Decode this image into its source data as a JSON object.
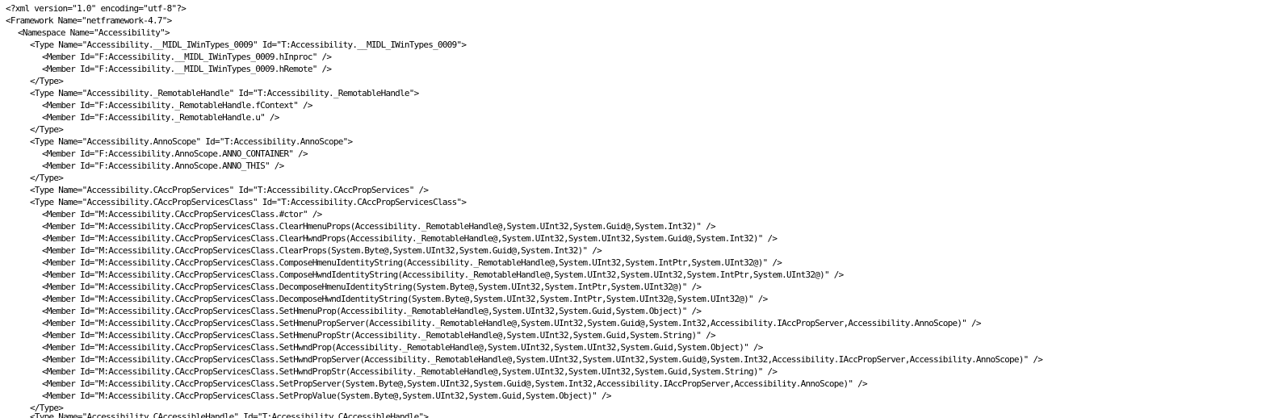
{
  "document": {
    "lines": [
      {
        "indent": 0,
        "text": "<?xml version=\"1.0\" encoding=\"utf-8\"?>"
      },
      {
        "indent": 0,
        "text": "<Framework Name=\"netframework-4.7\">"
      },
      {
        "indent": 1,
        "text": "<Namespace Name=\"Accessibility\">"
      },
      {
        "indent": 2,
        "text": "<Type Name=\"Accessibility.__MIDL_IWinTypes_0009\" Id=\"T:Accessibility.__MIDL_IWinTypes_0009\">"
      },
      {
        "indent": 3,
        "text": "<Member Id=\"F:Accessibility.__MIDL_IWinTypes_0009.hInproc\" />"
      },
      {
        "indent": 3,
        "text": "<Member Id=\"F:Accessibility.__MIDL_IWinTypes_0009.hRemote\" />"
      },
      {
        "indent": 2,
        "text": "</Type>"
      },
      {
        "indent": 2,
        "text": "<Type Name=\"Accessibility._RemotableHandle\" Id=\"T:Accessibility._RemotableHandle\">"
      },
      {
        "indent": 3,
        "text": "<Member Id=\"F:Accessibility._RemotableHandle.fContext\" />"
      },
      {
        "indent": 3,
        "text": "<Member Id=\"F:Accessibility._RemotableHandle.u\" />"
      },
      {
        "indent": 2,
        "text": "</Type>"
      },
      {
        "indent": 2,
        "text": "<Type Name=\"Accessibility.AnnoScope\" Id=\"T:Accessibility.AnnoScope\">"
      },
      {
        "indent": 3,
        "text": "<Member Id=\"F:Accessibility.AnnoScope.ANNO_CONTAINER\" />"
      },
      {
        "indent": 3,
        "text": "<Member Id=\"F:Accessibility.AnnoScope.ANNO_THIS\" />"
      },
      {
        "indent": 2,
        "text": "</Type>"
      },
      {
        "indent": 2,
        "text": "<Type Name=\"Accessibility.CAccPropServices\" Id=\"T:Accessibility.CAccPropServices\" />"
      },
      {
        "indent": 2,
        "text": "<Type Name=\"Accessibility.CAccPropServicesClass\" Id=\"T:Accessibility.CAccPropServicesClass\">"
      },
      {
        "indent": 3,
        "text": "<Member Id=\"M:Accessibility.CAccPropServicesClass.#ctor\" />"
      },
      {
        "indent": 3,
        "text": "<Member Id=\"M:Accessibility.CAccPropServicesClass.ClearHmenuProps(Accessibility._RemotableHandle@,System.UInt32,System.Guid@,System.Int32)\" />"
      },
      {
        "indent": 3,
        "text": "<Member Id=\"M:Accessibility.CAccPropServicesClass.ClearHwndProps(Accessibility._RemotableHandle@,System.UInt32,System.UInt32,System.Guid@,System.Int32)\" />"
      },
      {
        "indent": 3,
        "text": "<Member Id=\"M:Accessibility.CAccPropServicesClass.ClearProps(System.Byte@,System.UInt32,System.Guid@,System.Int32)\" />"
      },
      {
        "indent": 3,
        "text": "<Member Id=\"M:Accessibility.CAccPropServicesClass.ComposeHmenuIdentityString(Accessibility._RemotableHandle@,System.UInt32,System.IntPtr,System.UInt32@)\" />"
      },
      {
        "indent": 3,
        "text": "<Member Id=\"M:Accessibility.CAccPropServicesClass.ComposeHwndIdentityString(Accessibility._RemotableHandle@,System.UInt32,System.UInt32,System.IntPtr,System.UInt32@)\" />"
      },
      {
        "indent": 3,
        "text": "<Member Id=\"M:Accessibility.CAccPropServicesClass.DecomposeHmenuIdentityString(System.Byte@,System.UInt32,System.IntPtr,System.UInt32@)\" />"
      },
      {
        "indent": 3,
        "text": "<Member Id=\"M:Accessibility.CAccPropServicesClass.DecomposeHwndIdentityString(System.Byte@,System.UInt32,System.IntPtr,System.UInt32@,System.UInt32@)\" />"
      },
      {
        "indent": 3,
        "text": "<Member Id=\"M:Accessibility.CAccPropServicesClass.SetHmenuProp(Accessibility._RemotableHandle@,System.UInt32,System.Guid,System.Object)\" />"
      },
      {
        "indent": 3,
        "text": "<Member Id=\"M:Accessibility.CAccPropServicesClass.SetHmenuPropServer(Accessibility._RemotableHandle@,System.UInt32,System.Guid@,System.Int32,Accessibility.IAccPropServer,Accessibility.AnnoScope)\" />"
      },
      {
        "indent": 3,
        "text": "<Member Id=\"M:Accessibility.CAccPropServicesClass.SetHmenuPropStr(Accessibility._RemotableHandle@,System.UInt32,System.Guid,System.String)\" />"
      },
      {
        "indent": 3,
        "text": "<Member Id=\"M:Accessibility.CAccPropServicesClass.SetHwndProp(Accessibility._RemotableHandle@,System.UInt32,System.UInt32,System.Guid,System.Object)\" />"
      },
      {
        "indent": 3,
        "text": "<Member Id=\"M:Accessibility.CAccPropServicesClass.SetHwndPropServer(Accessibility._RemotableHandle@,System.UInt32,System.UInt32,System.Guid@,System.Int32,Accessibility.IAccPropServer,Accessibility.AnnoScope)\" />"
      },
      {
        "indent": 3,
        "text": "<Member Id=\"M:Accessibility.CAccPropServicesClass.SetHwndPropStr(Accessibility._RemotableHandle@,System.UInt32,System.UInt32,System.Guid,System.String)\" />"
      },
      {
        "indent": 3,
        "text": "<Member Id=\"M:Accessibility.CAccPropServicesClass.SetPropServer(System.Byte@,System.UInt32,System.Guid@,System.Int32,Accessibility.IAccPropServer,Accessibility.AnnoScope)\" />"
      },
      {
        "indent": 3,
        "text": "<Member Id=\"M:Accessibility.CAccPropServicesClass.SetPropValue(System.Byte@,System.UInt32,System.Guid,System.Object)\" />"
      },
      {
        "indent": 2,
        "text": "</Type>"
      },
      {
        "indent": 2,
        "text": "<Type Name=\"Accessibility.CAccessibleHandle\" Id=\"T:Accessibility.CAccessibleHandle\">"
      }
    ]
  }
}
